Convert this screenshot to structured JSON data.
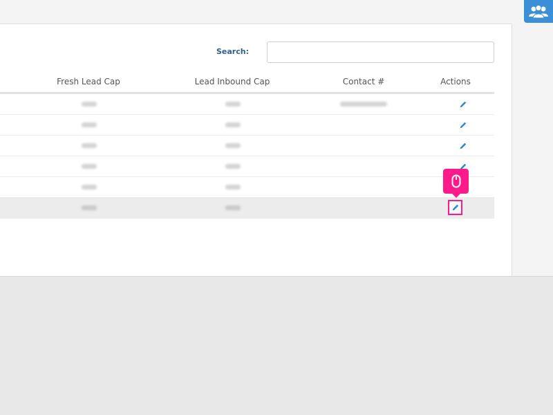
{
  "search": {
    "label": "Search:",
    "value": "",
    "placeholder": ""
  },
  "table": {
    "columns": [
      "Fresh Lead Cap",
      "Lead Inbound Cap",
      "Contact #",
      "Actions"
    ],
    "rows": [
      {
        "fresh_lead_cap": "",
        "lead_inbound_cap": "",
        "contact": "",
        "selected": false
      },
      {
        "fresh_lead_cap": "",
        "lead_inbound_cap": "",
        "contact": "",
        "selected": false
      },
      {
        "fresh_lead_cap": "",
        "lead_inbound_cap": "",
        "contact": "",
        "selected": false
      },
      {
        "fresh_lead_cap": "",
        "lead_inbound_cap": "",
        "contact": "",
        "selected": false
      },
      {
        "fresh_lead_cap": "",
        "lead_inbound_cap": "",
        "contact": "",
        "selected": false
      },
      {
        "fresh_lead_cap": "",
        "lead_inbound_cap": "",
        "contact": "",
        "selected": true
      }
    ]
  },
  "icons": {
    "users": "users-icon",
    "edit": "pencil-icon",
    "click_indicator": "mouse-icon"
  },
  "colors": {
    "accent": "#3b8fd6",
    "edit_icon": "#2a8ad4",
    "highlight": "#ff1a8c",
    "search_label": "#2f5f8f"
  }
}
